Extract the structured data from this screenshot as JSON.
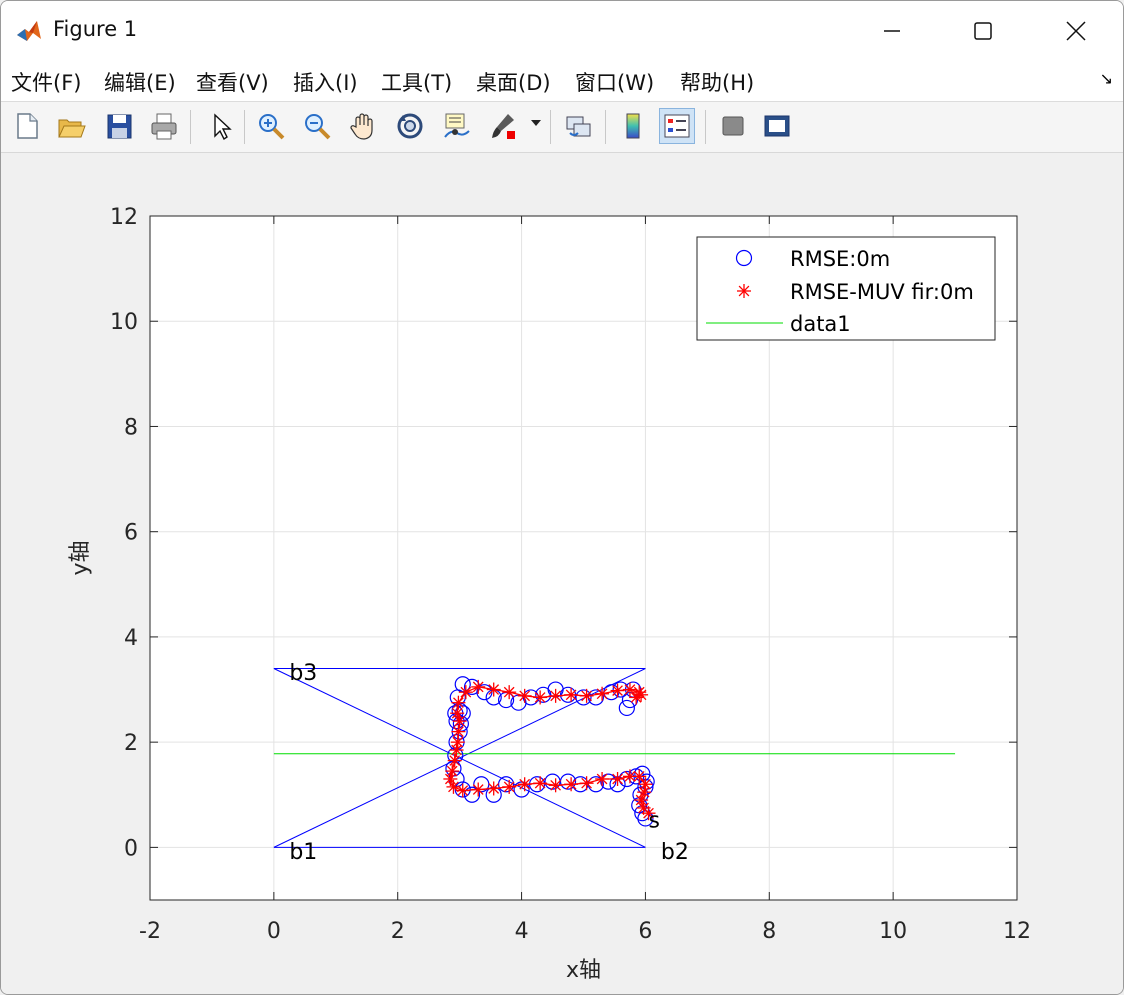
{
  "window": {
    "title": "Figure 1",
    "minimize_icon": "minimize-icon",
    "maximize_icon": "maximize-icon",
    "close_icon": "close-icon"
  },
  "menubar": {
    "items": [
      "文件(F)",
      "编辑(E)",
      "查看(V)",
      "插入(I)",
      "工具(T)",
      "桌面(D)",
      "窗口(W)",
      "帮助(H)"
    ],
    "overflow_icon": "dock-arrow-icon"
  },
  "toolbar": {
    "buttons": [
      "new-figure-icon",
      "open-icon",
      "save-icon",
      "print-icon",
      "edit-plot-arrow-icon",
      "zoom-in-icon",
      "zoom-out-icon",
      "pan-hand-icon",
      "rotate-3d-icon",
      "data-cursor-icon",
      "brush-icon",
      "link-plot-icon",
      "colorbar-icon",
      "legend-icon",
      "hide-plot-tools-icon",
      "show-plot-tools-icon"
    ],
    "active": "legend-icon"
  },
  "chart_data": {
    "type": "scatter",
    "title": "",
    "xlabel": "x轴",
    "ylabel": "y轴",
    "xlim": [
      -2,
      12
    ],
    "ylim": [
      -1,
      12
    ],
    "xticks": [
      "-2",
      "0",
      "2",
      "4",
      "6",
      "8",
      "10",
      "12"
    ],
    "yticks": [
      "0",
      "2",
      "4",
      "6",
      "8",
      "10",
      "12"
    ],
    "grid": true,
    "legend_position": "top-right",
    "colors": {
      "circles": "#0000ff",
      "stars": "#ff0000",
      "data1": "#00dd00",
      "anchor_lines": "#0000ff"
    },
    "series": [
      {
        "name": "RMSE:0m",
        "marker": "circle",
        "x": [
          6.0,
          5.95,
          5.9,
          5.92,
          6.0,
          6.02,
          5.95,
          5.85,
          5.7,
          5.55,
          5.4,
          5.2,
          4.95,
          4.75,
          4.5,
          4.25,
          4.0,
          3.75,
          3.55,
          3.35,
          3.2,
          3.05,
          2.95,
          2.9,
          2.93,
          2.95,
          3.0,
          3.02,
          3.05,
          3.0,
          2.95,
          2.93,
          2.97,
          3.05,
          3.2,
          3.4,
          3.55,
          3.75,
          3.95,
          4.15,
          4.35,
          4.55,
          4.75,
          5.0,
          5.2,
          5.45,
          5.6,
          5.7,
          5.75,
          5.8
        ],
        "y": [
          0.55,
          0.65,
          0.8,
          1.0,
          1.15,
          1.25,
          1.4,
          1.35,
          1.3,
          1.2,
          1.25,
          1.2,
          1.2,
          1.25,
          1.25,
          1.2,
          1.1,
          1.2,
          1.0,
          1.2,
          1.0,
          1.1,
          1.3,
          1.5,
          1.75,
          2.0,
          2.2,
          2.35,
          2.55,
          2.6,
          2.4,
          2.55,
          2.85,
          3.1,
          3.05,
          2.95,
          2.85,
          2.8,
          2.75,
          2.85,
          2.9,
          3.0,
          2.9,
          2.85,
          2.85,
          2.95,
          3.0,
          2.65,
          2.8,
          3.0
        ]
      },
      {
        "name": "RMSE-MUV fir:0m",
        "marker": "star",
        "x": [
          6.05,
          5.97,
          5.93,
          5.98,
          6.0,
          5.9,
          5.75,
          5.55,
          5.3,
          5.05,
          4.8,
          4.55,
          4.3,
          4.05,
          3.8,
          3.55,
          3.3,
          3.05,
          2.9,
          2.85,
          2.88,
          2.92,
          2.95,
          2.97,
          2.98,
          3.0,
          2.96,
          2.98,
          3.1,
          3.3,
          3.55,
          3.8,
          4.05,
          4.3,
          4.55,
          4.8,
          5.05,
          5.3,
          5.55,
          5.75,
          5.9,
          5.93,
          5.85
        ],
        "y": [
          0.65,
          0.75,
          0.9,
          1.05,
          1.2,
          1.35,
          1.35,
          1.3,
          1.3,
          1.22,
          1.2,
          1.18,
          1.22,
          1.2,
          1.15,
          1.12,
          1.1,
          1.08,
          1.15,
          1.3,
          1.45,
          1.65,
          1.85,
          2.0,
          2.2,
          2.4,
          2.55,
          2.75,
          2.95,
          3.05,
          3.0,
          2.95,
          2.88,
          2.85,
          2.88,
          2.9,
          2.88,
          2.92,
          2.98,
          3.0,
          2.95,
          2.9,
          2.85
        ]
      },
      {
        "name": "data1",
        "marker": "line",
        "x": [
          0,
          11
        ],
        "y": [
          1.78,
          1.78
        ]
      }
    ],
    "anchor_lines": [
      {
        "x": [
          0,
          6
        ],
        "y": [
          0,
          0
        ]
      },
      {
        "x": [
          0,
          6
        ],
        "y": [
          3.4,
          3.4
        ]
      },
      {
        "x": [
          0,
          6
        ],
        "y": [
          0,
          3.4
        ]
      },
      {
        "x": [
          0,
          6
        ],
        "y": [
          3.4,
          0
        ]
      }
    ],
    "annotations": [
      {
        "text": "b1",
        "x": 0.25,
        "y": -0.05
      },
      {
        "text": "b2",
        "x": 6.25,
        "y": -0.05
      },
      {
        "text": "b3",
        "x": 0.25,
        "y": 3.35
      },
      {
        "text": "s",
        "x": 6.05,
        "y": 0.55
      }
    ]
  }
}
